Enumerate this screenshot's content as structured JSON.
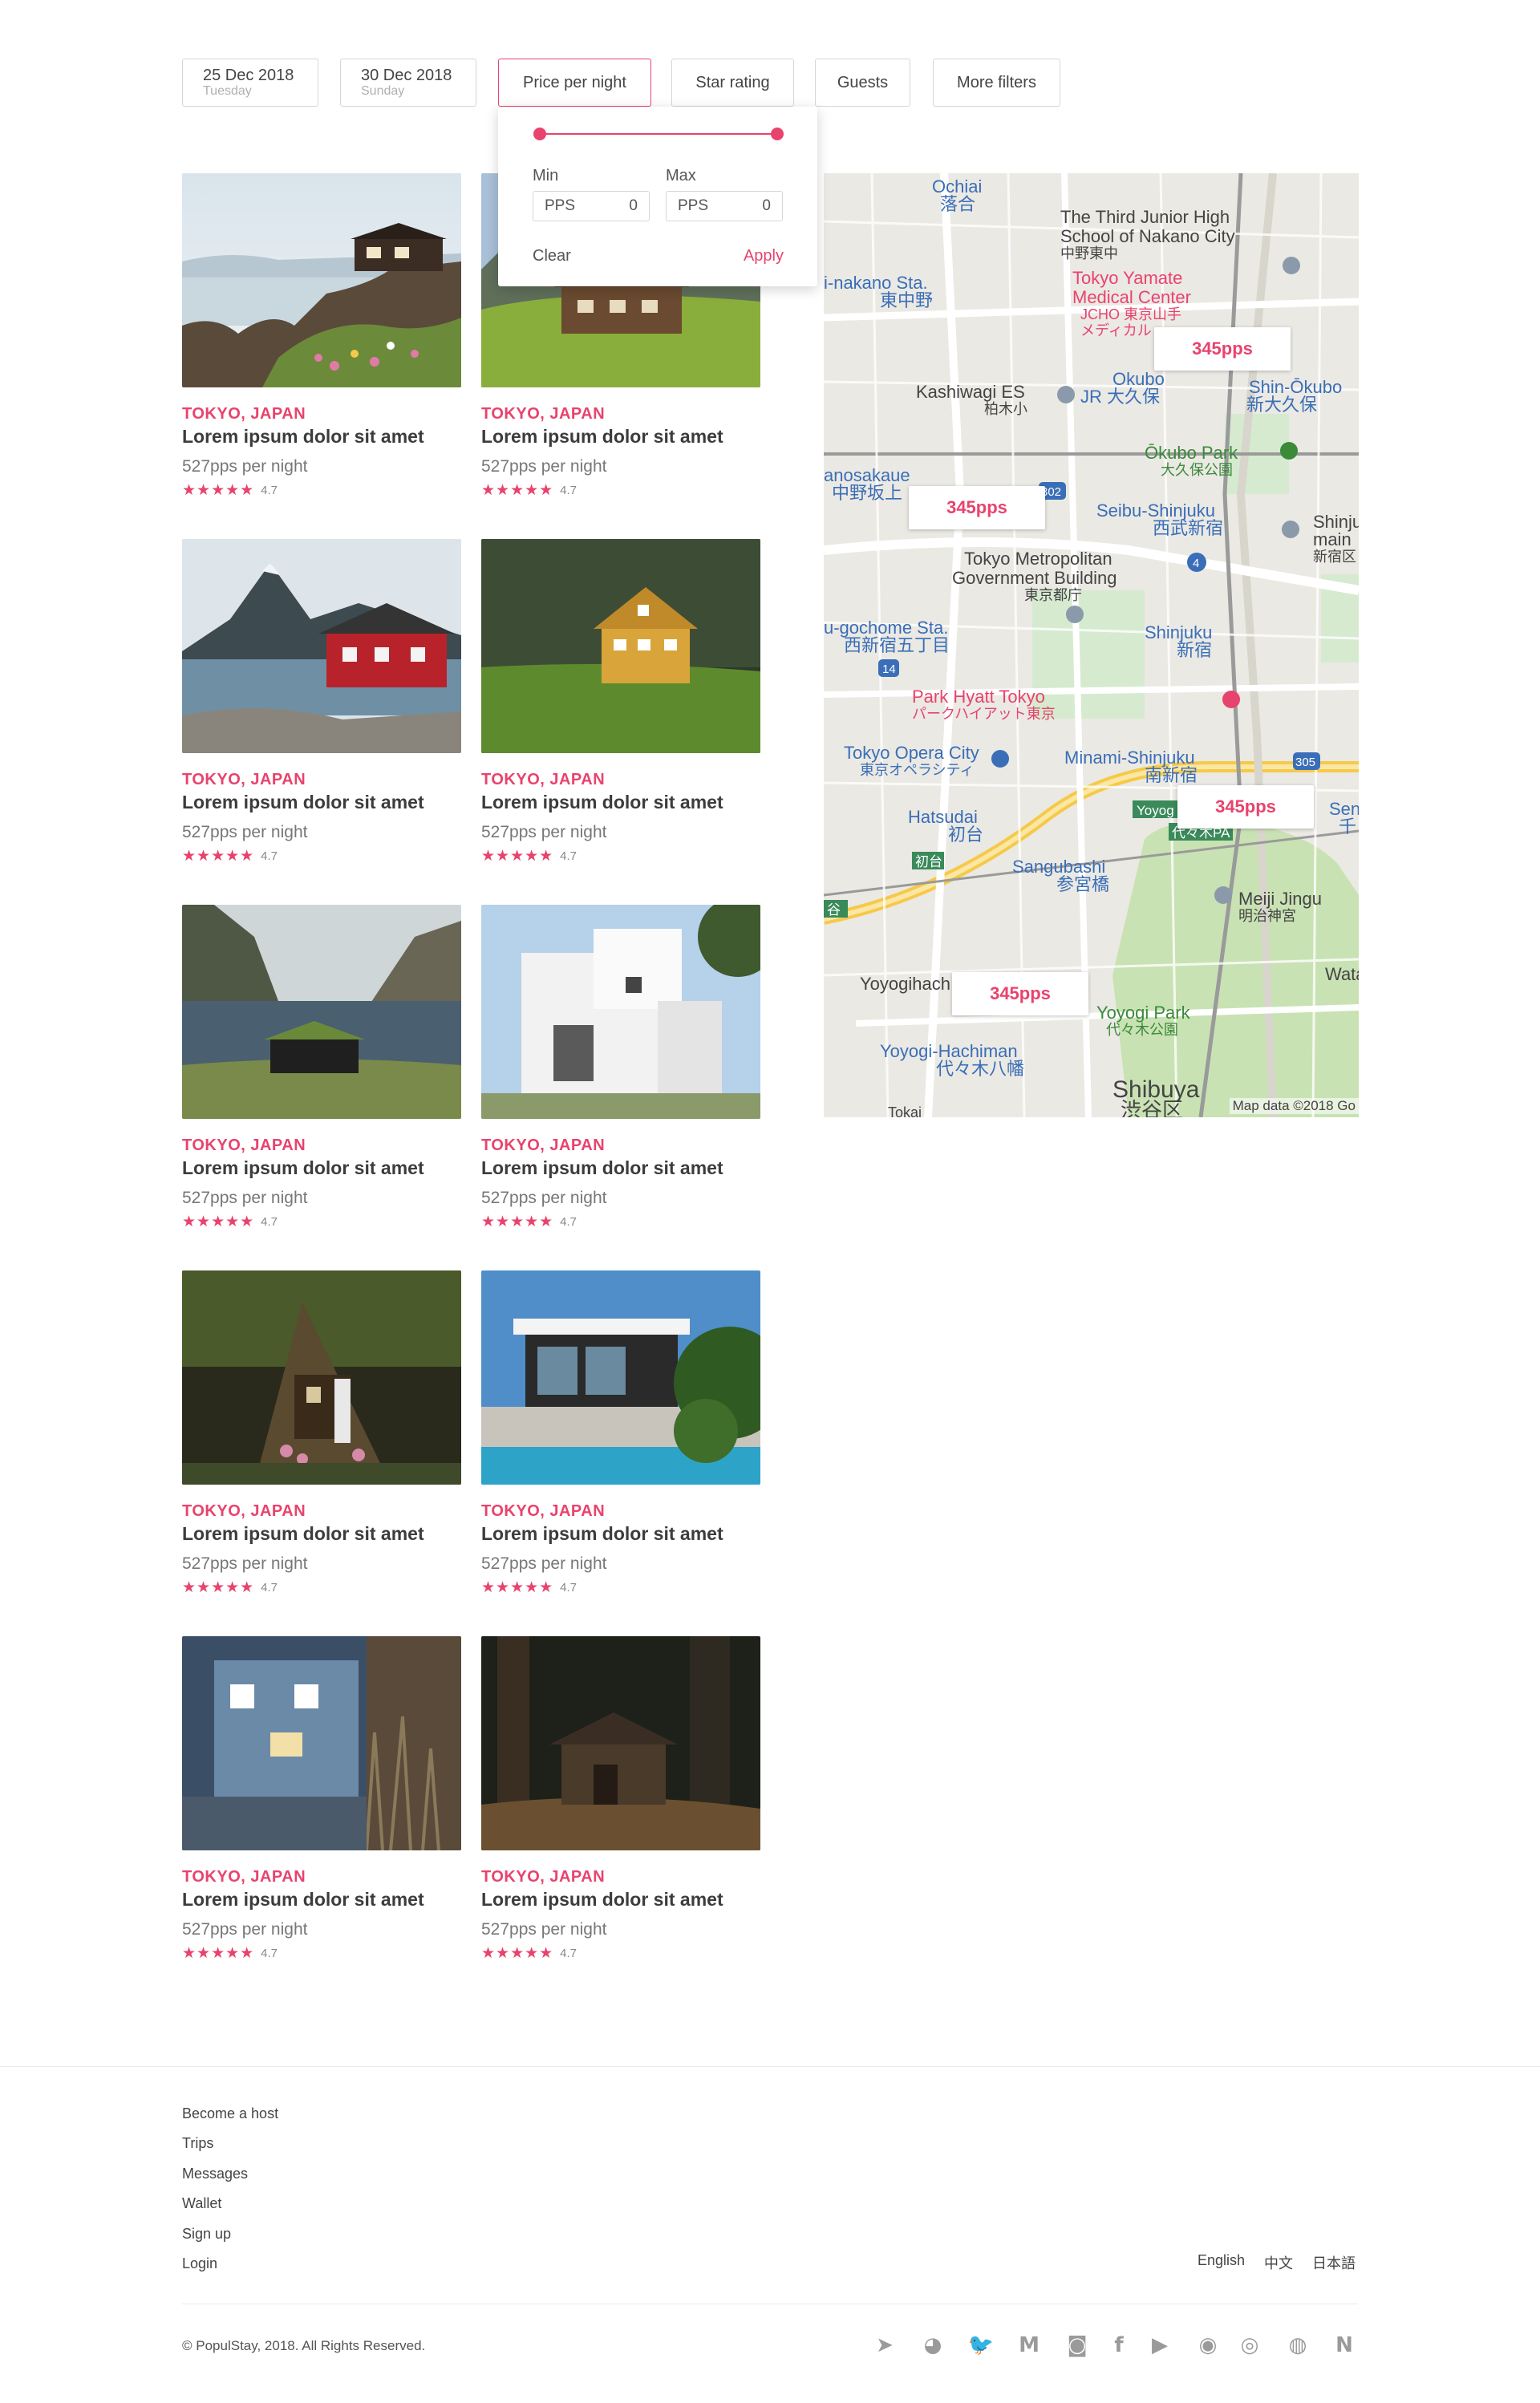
{
  "filters": {
    "checkin": {
      "date": "25 Dec 2018",
      "day": "Tuesday"
    },
    "checkout": {
      "date": "30 Dec 2018",
      "day": "Sunday"
    },
    "price": "Price per night",
    "stars": "Star rating",
    "guests": "Guests",
    "more": "More filters"
  },
  "price_popover": {
    "min_label": "Min",
    "max_label": "Max",
    "min_currency": "PPS",
    "min_value": "0",
    "max_currency": "PPS",
    "max_value": "0",
    "clear": "Clear",
    "apply": "Apply",
    "accent": "#e8436d"
  },
  "listings": [
    {
      "location": "TOKYO, JAPAN",
      "title": "Lorem ipsum dolor sit amet",
      "price": "527pps per night",
      "stars": "★★★★★",
      "rating": "4.7",
      "image": "coastal-cliff-house"
    },
    {
      "location": "TOKYO, JAPAN",
      "title": "Lorem ipsum dolor sit amet",
      "price": "527pps per night",
      "stars": "★★★★★",
      "rating": "4.7",
      "image": "alpine-chalet"
    },
    {
      "location": "TOKYO, JAPAN",
      "title": "Lorem ipsum dolor sit amet",
      "price": "527pps per night",
      "stars": "★★★★★",
      "rating": "4.7",
      "image": "red-cabin-fjord"
    },
    {
      "location": "TOKYO, JAPAN",
      "title": "Lorem ipsum dolor sit amet",
      "price": "527pps per night",
      "stars": "★★★★★",
      "rating": "4.7",
      "image": "yellow-house-meadow"
    },
    {
      "location": "TOKYO, JAPAN",
      "title": "Lorem ipsum dolor sit amet",
      "price": "527pps per night",
      "stars": "★★★★★",
      "rating": "4.7",
      "image": "lake-grass-hut"
    },
    {
      "location": "TOKYO, JAPAN",
      "title": "Lorem ipsum dolor sit amet",
      "price": "527pps per night",
      "stars": "★★★★★",
      "rating": "4.7",
      "image": "white-modern-house"
    },
    {
      "location": "TOKYO, JAPAN",
      "title": "Lorem ipsum dolor sit amet",
      "price": "527pps per night",
      "stars": "★★★★★",
      "rating": "4.7",
      "image": "forest-treehouse"
    },
    {
      "location": "TOKYO, JAPAN",
      "title": "Lorem ipsum dolor sit amet",
      "price": "527pps per night",
      "stars": "★★★★★",
      "rating": "4.7",
      "image": "pool-villa"
    },
    {
      "location": "TOKYO, JAPAN",
      "title": "Lorem ipsum dolor sit amet",
      "price": "527pps per night",
      "stars": "★★★★★",
      "rating": "4.7",
      "image": "blue-shingle-house"
    },
    {
      "location": "TOKYO, JAPAN",
      "title": "Lorem ipsum dolor sit amet",
      "price": "527pps per night",
      "stars": "★★★★★",
      "rating": "4.7",
      "image": "woodland-cabin"
    }
  ],
  "map": {
    "pins": [
      "345pps",
      "345pps",
      "345pps",
      "345pps"
    ],
    "credit": "Map data ©2018 Go",
    "labels": {
      "ochiai": "Ochiai",
      "ochiai_jp": "落合",
      "junior": "The Third Junior High",
      "junior2": "School of Nakano City",
      "junior_jp": "中野東中",
      "yamate": "Tokyo Yamate",
      "yamate2": "Medical Center",
      "yamate_jp": "JCHO 東京山手",
      "yamate_jp2": "メディカル",
      "nakano": "i-nakano Sta.",
      "nakano_jp": "東中野",
      "okubo": "Okubo",
      "okubo_jp": "JR 大久保",
      "shinokubo": "Shin-Ōkubo",
      "shinokubo_jp": "新大久保",
      "kashiwagi": "Kashiwagi ES",
      "kashiwagi_jp": "柏木小",
      "okubopark": "Ōkubo Park",
      "okubopark_jp": "大久保公園",
      "sakaue": "anosakaue",
      "sakaue_jp": "中野坂上",
      "seibu": "Seibu-Shinjuku",
      "seibu_jp": "西武新宿",
      "shinjumain": "Shinju",
      "shinjumain2": "main",
      "shinjumain_jp": "新宿区",
      "metro": "Tokyo Metropolitan",
      "metro2": "Government Building",
      "metro_jp": "東京都庁",
      "gochome": "u-gochome Sta.",
      "gochome_jp": "西新宿五丁目",
      "shinjuku": "Shinjuku",
      "shinjuku_jp": "新宿",
      "hyatt": "Park Hyatt Tokyo",
      "hyatt_jp": "パークハイアット東京",
      "opera": "Tokyo Opera City",
      "opera_jp": "東京オペラシティ",
      "minami": "Minami-Shinjuku",
      "minami_jp": "南新宿",
      "hatsudai": "Hatsudai",
      "hatsudai_jp": "初台",
      "hatsudai_exit": "初台",
      "yoyo": "Yoyog",
      "yoyo_jp": "代々木PA",
      "sangubashi": "Sangubashi",
      "sangubashi_jp": "参宮橋",
      "meiji": "Meiji Jingu",
      "meiji_jp": "明治神宮",
      "yoyogihach": "Yoyogihach",
      "yoyogipark": "Yoyogi Park",
      "yoyogipark_jp": "代々木公園",
      "hachiman": "Yoyogi-Hachiman",
      "hachiman_jp": "代々木八幡",
      "shibuya": "Shibuya",
      "shibuya_jp": "渋谷区",
      "watari": "Watari",
      "sen": "Sen",
      "sen_jp": "千",
      "tokai": "Tokai",
      "r14": "14",
      "r302": "302",
      "r305": "305",
      "r4": "4",
      "tai": "谷"
    }
  },
  "footer": {
    "links": [
      "Become a host",
      "Trips",
      "Messages",
      "Wallet",
      "Sign up",
      "Login"
    ],
    "languages": [
      "English",
      "中文",
      "日本語"
    ],
    "copyright": "© PopulStay, 2018. All Rights Reserved.",
    "social": [
      {
        "name": "telegram-icon",
        "glyph": "➤"
      },
      {
        "name": "wechat-icon",
        "glyph": "◕"
      },
      {
        "name": "twitter-icon",
        "glyph": "🐦"
      },
      {
        "name": "medium-icon",
        "glyph": "M"
      },
      {
        "name": "instagram-icon",
        "glyph": "◙"
      },
      {
        "name": "facebook-icon",
        "glyph": "f"
      },
      {
        "name": "youtube-icon",
        "glyph": "▶"
      },
      {
        "name": "github-icon",
        "glyph": "◉"
      },
      {
        "name": "reddit-icon",
        "glyph": "◎"
      },
      {
        "name": "weibo-icon",
        "glyph": "◍"
      },
      {
        "name": "n-icon",
        "glyph": "N"
      }
    ]
  }
}
